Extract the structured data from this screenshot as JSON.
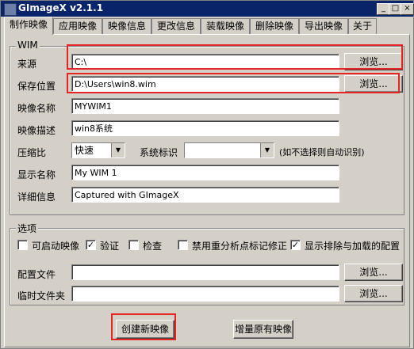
{
  "window": {
    "title": "GImageX v2.1.1",
    "controls": [
      "_",
      "□",
      "×"
    ]
  },
  "tabs": [
    "制作映像",
    "应用映像",
    "映像信息",
    "更改信息",
    "装载映像",
    "删除映像",
    "导出映像",
    "关于"
  ],
  "wim": {
    "group_title": "WIM",
    "source_label": "来源",
    "source_value": "C:\\",
    "save_label": "保存位置",
    "save_value": "D:\\Users\\win8.wim",
    "name_label": "映像名称",
    "name_value": "MYWIM1",
    "desc_label": "映像描述",
    "desc_value": "win8系统",
    "compress_label": "压缩比",
    "compress_value": "快速",
    "sysflag_label": "系统标识",
    "sysflag_value": "",
    "sysflag_hint": "(如不选择则自动识别)",
    "display_label": "显示名称",
    "display_value": "My WIM 1",
    "detail_label": "详细信息",
    "detail_value": "Captured with GImageX",
    "browse_label": "浏览..."
  },
  "options": {
    "group_title": "选项",
    "checkboxes": [
      {
        "label": "可启动映像",
        "checked": false
      },
      {
        "label": "验证",
        "checked": true
      },
      {
        "label": "检查",
        "checked": false
      },
      {
        "label": "禁用重分析点标记修正",
        "checked": false
      },
      {
        "label": "显示排除与加载的配置",
        "checked": true
      }
    ],
    "config_label": "配置文件",
    "config_value": "",
    "temp_label": "临时文件夹",
    "temp_value": "",
    "browse_label": "浏览..."
  },
  "actions": {
    "create_label": "创建新映像",
    "append_label": "增量原有映像"
  }
}
